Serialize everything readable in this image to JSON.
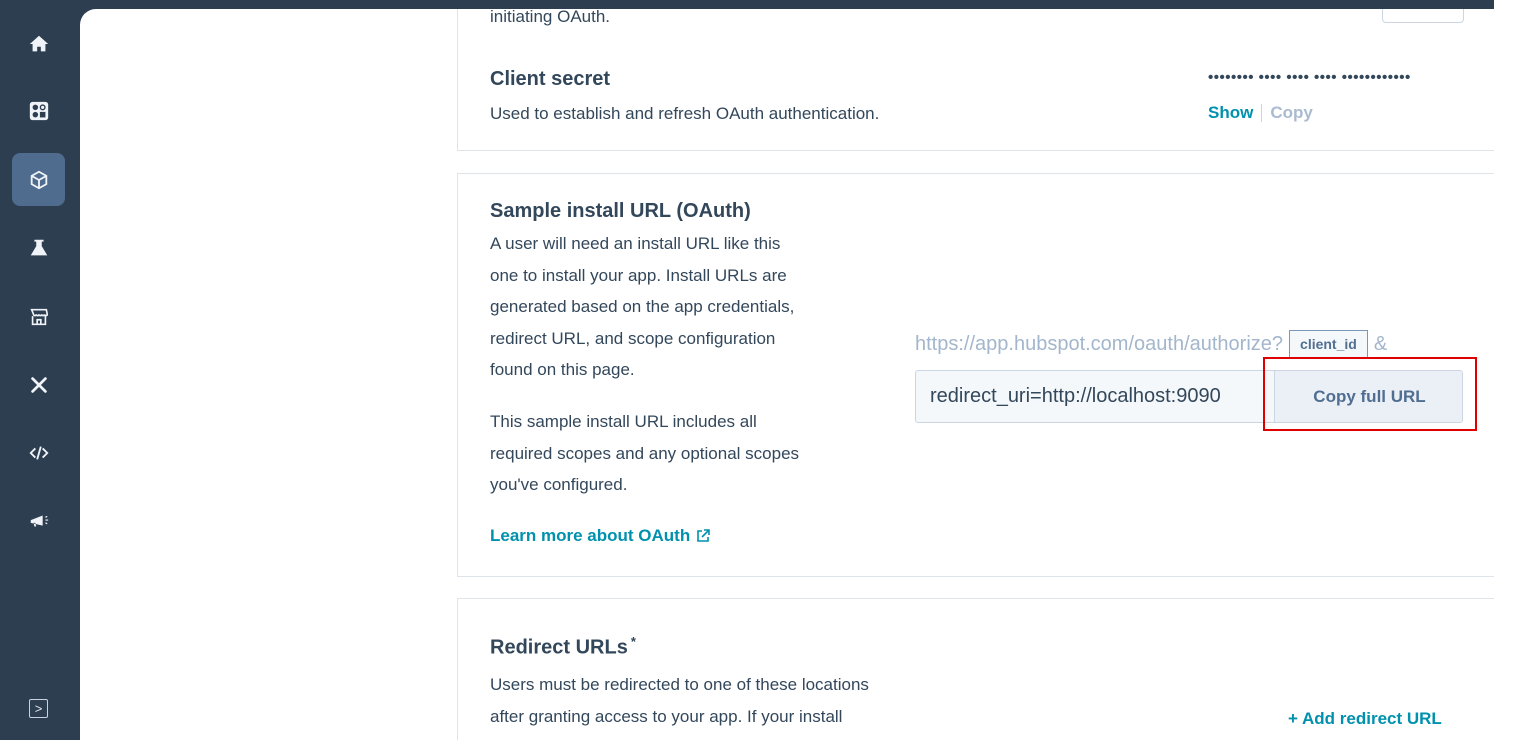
{
  "sidebar": {
    "items": [
      {
        "icon": "home-icon"
      },
      {
        "icon": "apps-grid-icon"
      },
      {
        "icon": "cube-icon",
        "active": true
      },
      {
        "icon": "flask-icon"
      },
      {
        "icon": "storefront-icon"
      },
      {
        "icon": "tools-icon"
      },
      {
        "icon": "code-icon"
      },
      {
        "icon": "megaphone-icon"
      }
    ],
    "expand_icon": "chevron-right-icon"
  },
  "client_id_section": {
    "partial_text": "initiating OAuth."
  },
  "client_secret": {
    "title": "Client secret",
    "description": "Used to establish and refresh OAuth authentication.",
    "masked_value": "•••••••• •••• •••• •••• ••••••••••••",
    "show_label": "Show",
    "copy_label": "Copy"
  },
  "install_url": {
    "title": "Sample install URL (OAuth)",
    "description_lines": [
      "A user will need an install URL like this",
      "one to install your app. Install URLs are",
      "generated based on the app credentials,",
      "redirect URL, and scope configuration",
      "found on this page."
    ],
    "scopes_lines": [
      "This sample install URL includes all",
      "required scopes and any optional scopes",
      "you've configured."
    ],
    "learn_more": "Learn more about OAuth",
    "base_url": "https://app.hubspot.com/oauth/authorize?",
    "client_id_tag": "client_id",
    "ampersand": "&",
    "field_value": "redirect_uri=http://localhost:9090",
    "copy_button": "Copy full URL",
    "highlight_color": "#e00000"
  },
  "redirect_urls": {
    "title": "Redirect URLs",
    "required_mark": "*",
    "description_lines": [
      "Users must be redirected to one of these locations",
      "after granting access to your app. If your install"
    ],
    "add_label": "+ Add redirect URL"
  },
  "colors": {
    "sidebar": "#2d3e50",
    "accent": "#0091ae",
    "text": "#33475b"
  }
}
